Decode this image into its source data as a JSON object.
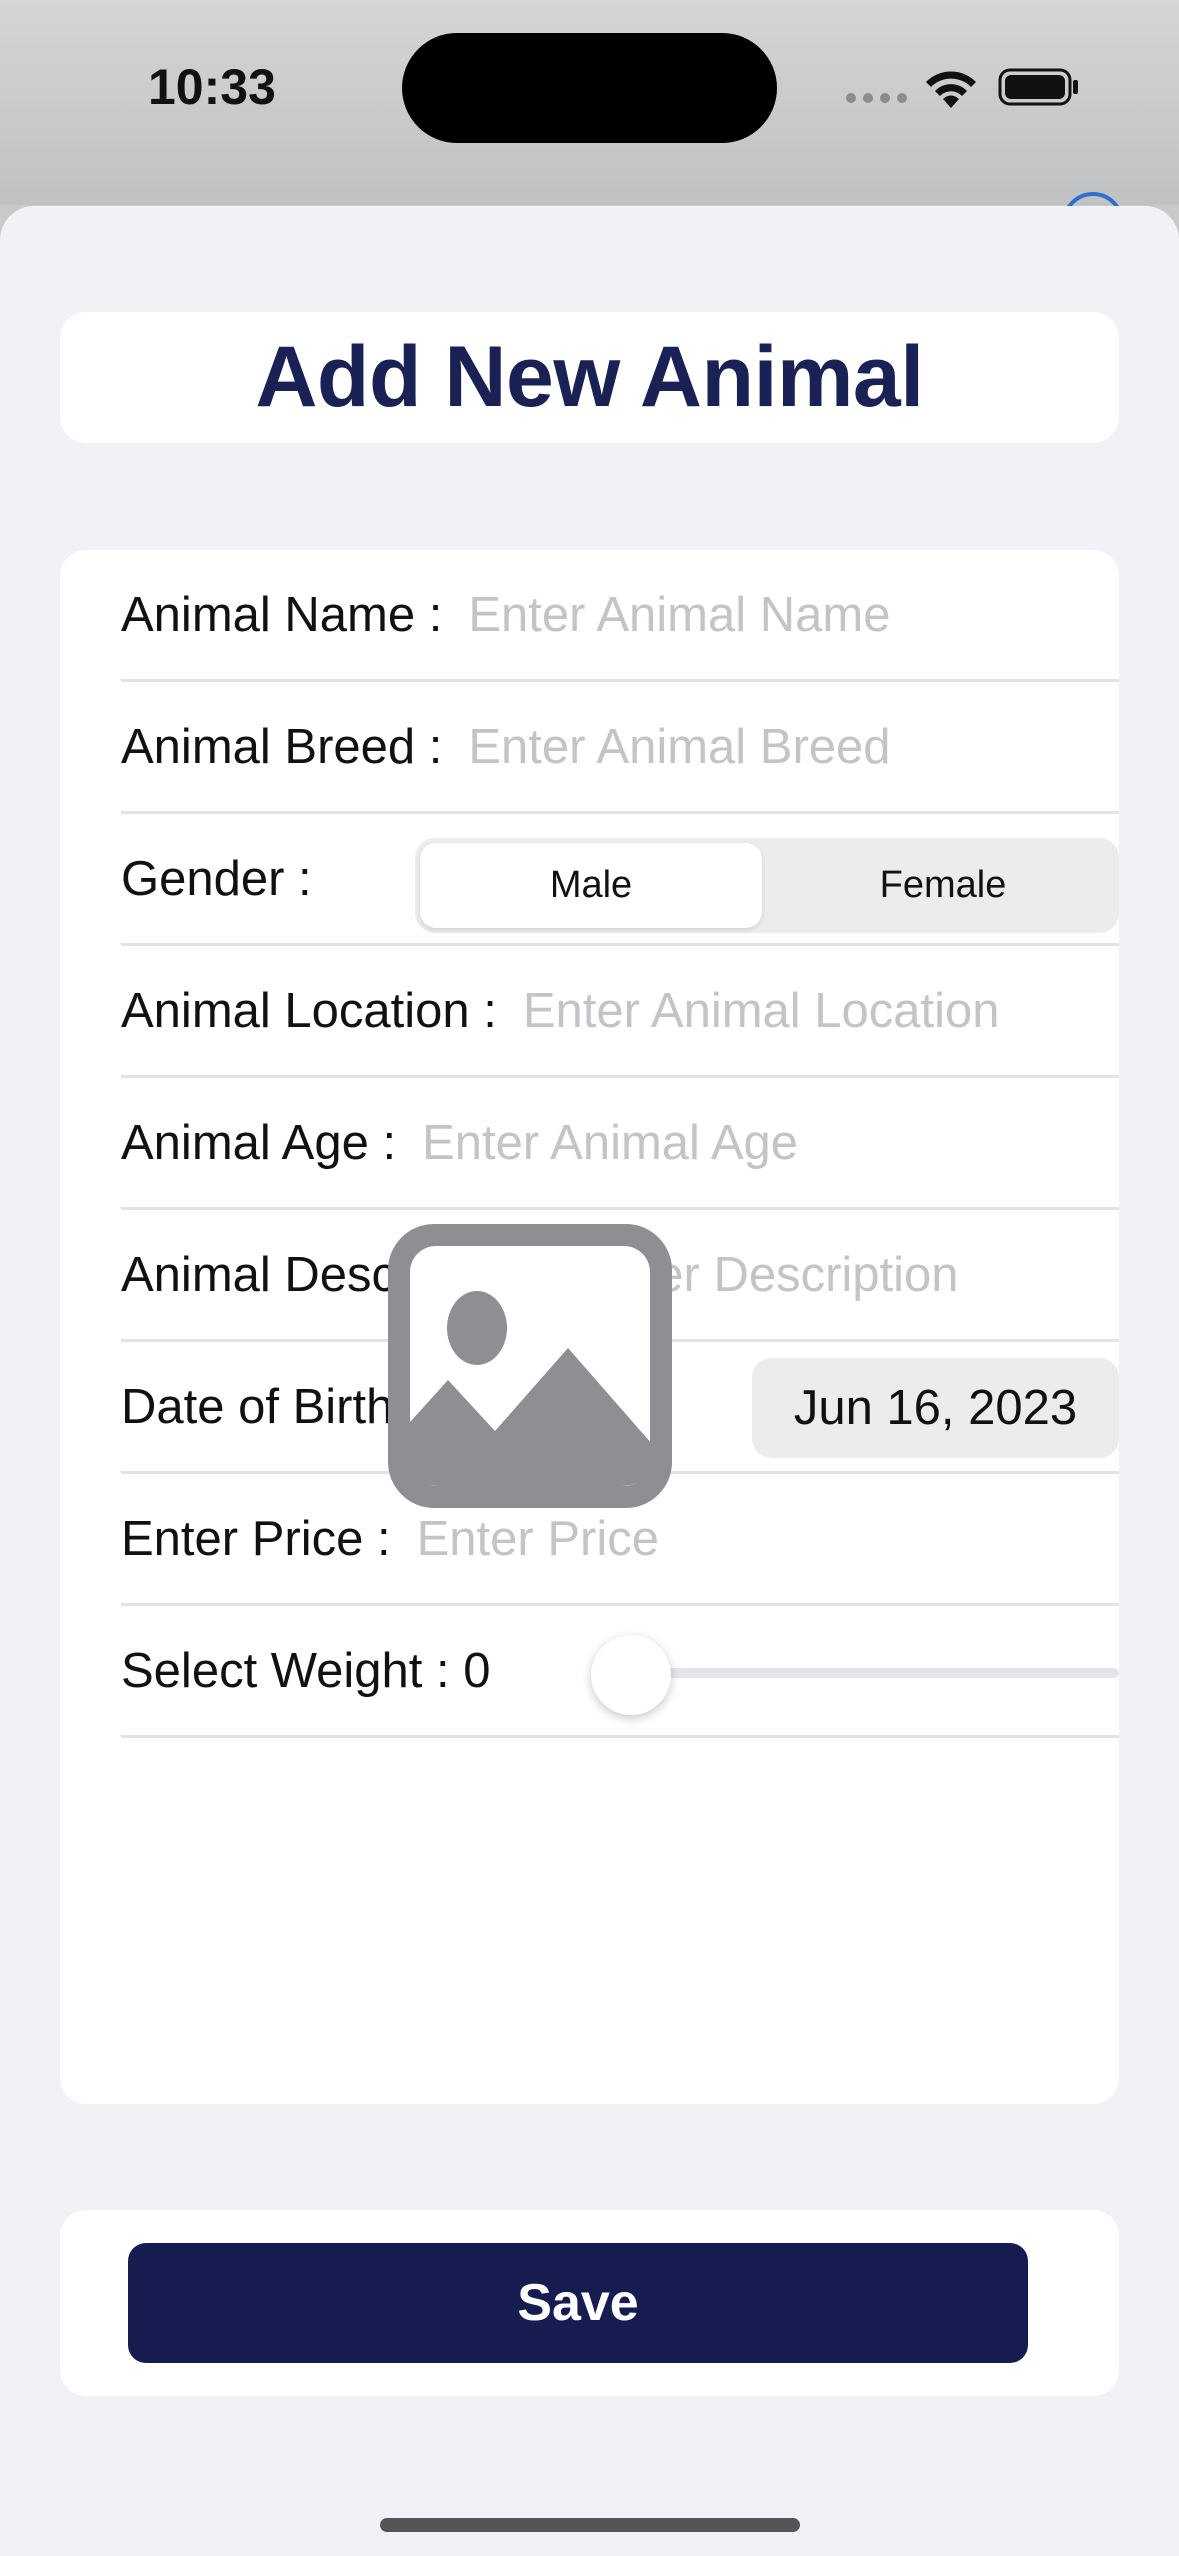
{
  "status_bar": {
    "time": "10:33",
    "icons": [
      "signal-dots-icon",
      "wifi-icon",
      "battery-icon"
    ]
  },
  "header": {
    "title": "Add New Animal"
  },
  "form": {
    "animal_name": {
      "label": "Animal Name :",
      "value": "",
      "placeholder": "Enter Animal Name"
    },
    "animal_breed": {
      "label": "Animal Breed :",
      "value": "",
      "placeholder": "Enter Animal Breed"
    },
    "gender": {
      "label": "Gender :",
      "options": [
        "Male",
        "Female"
      ],
      "selected": "Male"
    },
    "animal_location": {
      "label": "Animal Location :",
      "value": "",
      "placeholder": "Enter Animal Location"
    },
    "animal_age": {
      "label": "Animal Age :",
      "value": "",
      "placeholder": "Enter Animal Age"
    },
    "animal_description": {
      "label": "Animal Description :",
      "value": "",
      "placeholder": "Enter Description"
    },
    "date_of_birth": {
      "label": "Date of Birth :",
      "value": "Jun 16, 2023"
    },
    "price": {
      "label": "Enter Price :",
      "value": "",
      "placeholder": "Enter Price"
    },
    "weight": {
      "label": "Select Weight : 0",
      "value": 0,
      "fraction": 0
    },
    "image": {
      "icon": "photo-placeholder-icon"
    }
  },
  "actions": {
    "save_label": "Save"
  },
  "colors": {
    "title": "#1a2154",
    "save_button": "#161c4f",
    "placeholder": "#c4c4c8",
    "sheet_background": "#f1f1f6",
    "image_icon": "#8e8e93"
  }
}
